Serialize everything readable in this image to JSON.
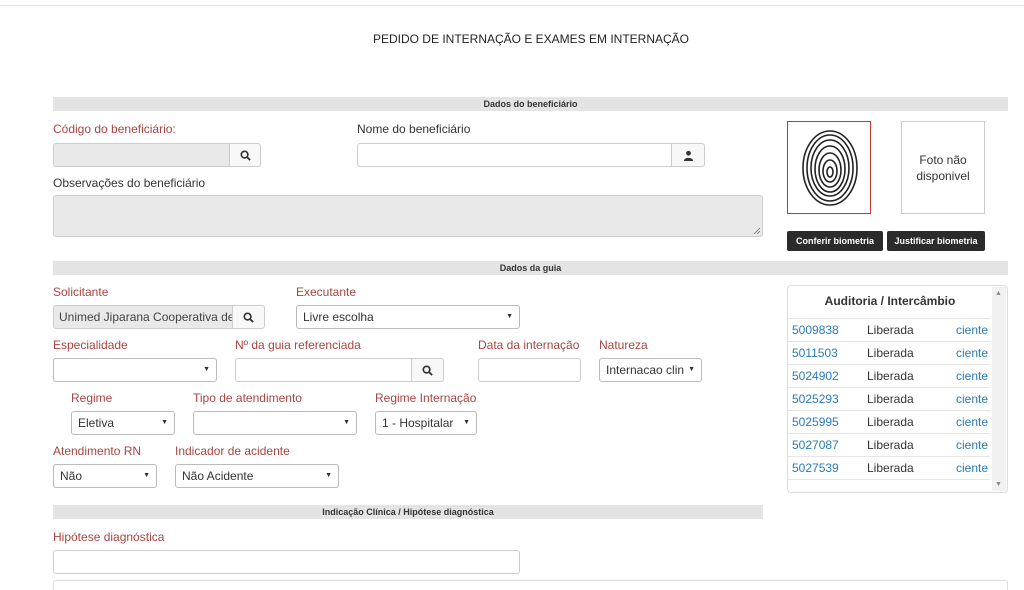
{
  "page": {
    "title": "PEDIDO DE INTERNAÇÃO E EXAMES EM INTERNAÇÃO"
  },
  "beneficiario": {
    "section_title": "Dados do beneficiário",
    "codigo_label": "Código do beneficiário:",
    "codigo_value": "",
    "nome_label": "Nome do beneficiário",
    "nome_value": "",
    "observacoes_label": "Observações do beneficiário",
    "foto_text": "Foto não disponivel",
    "conferir_label": "Conferir biometria",
    "justificar_label": "Justificar biometria"
  },
  "guia": {
    "section_title": "Dados da guia",
    "solicitante_label": "Solicitante",
    "solicitante_value": "Unimed Jiparana Cooperativa de",
    "executante_label": "Executante",
    "executante_value": "Livre escolha",
    "especialidade_label": "Especialidade",
    "especialidade_value": "",
    "guia_ref_label": "Nº da guia referenciada",
    "data_internacao_label": "Data da internação",
    "natureza_label": "Natureza",
    "natureza_value": "Internacao clin",
    "regime_label": "Regime",
    "regime_value": "Eletiva",
    "tipo_atendimento_label": "Tipo de atendimento",
    "tipo_atendimento_value": "",
    "regime_internacao_label": "Regime Internação",
    "regime_internacao_value": "1 - Hospitalar",
    "atendimento_rn_label": "Atendimento RN",
    "atendimento_rn_value": "Não",
    "indicador_acidente_label": "Indicador de acidente",
    "indicador_acidente_value": "Não Acidente"
  },
  "auditoria": {
    "title": "Auditoria / Intercâmbio",
    "rows": [
      {
        "id": "5009838",
        "status": "Liberada",
        "action": "ciente"
      },
      {
        "id": "5011503",
        "status": "Liberada",
        "action": "ciente"
      },
      {
        "id": "5024902",
        "status": "Liberada",
        "action": "ciente"
      },
      {
        "id": "5025293",
        "status": "Liberada",
        "action": "ciente"
      },
      {
        "id": "5025995",
        "status": "Liberada",
        "action": "ciente"
      },
      {
        "id": "5027087",
        "status": "Liberada",
        "action": "ciente"
      },
      {
        "id": "5027539",
        "status": "Liberada",
        "action": "ciente"
      }
    ]
  },
  "clinica": {
    "section_title": "Indicação Clínica / Hipótese diagnóstica",
    "hipotese_label": "Hipótese diagnóstica",
    "hipotese_value": ""
  },
  "colors": {
    "label_red": "#a94442",
    "link": "#2a7ab8",
    "section_bg": "#e4e4e4",
    "dark_button": "#2b2b2b"
  }
}
